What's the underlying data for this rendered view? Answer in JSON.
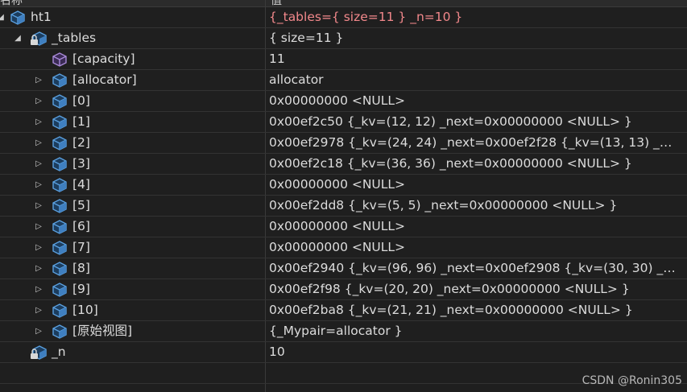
{
  "header": {
    "col_name": "名称",
    "col_value": "值"
  },
  "rows": [
    {
      "name": "ht1",
      "value": "{_tables={ size=11 } _n=10 }",
      "expander": "expanded-partial",
      "icon": "object-icon"
    },
    {
      "name": "_tables",
      "value": "{ size=11 }",
      "expander": "expanded",
      "icon": "locked-member-icon"
    },
    {
      "name": "[capacity]",
      "value": "11",
      "expander": "none",
      "icon": "property-icon"
    },
    {
      "name": "[allocator]",
      "value": "allocator",
      "expander": "collapsed",
      "icon": "object-icon"
    },
    {
      "name": "[0]",
      "value": "0x00000000 <NULL>",
      "expander": "collapsed",
      "icon": "object-icon"
    },
    {
      "name": "[1]",
      "value": "0x00ef2c50 {_kv=(12, 12) _next=0x00000000 <NULL> }",
      "expander": "collapsed",
      "icon": "object-icon"
    },
    {
      "name": "[2]",
      "value": "0x00ef2978 {_kv=(24, 24) _next=0x00ef2f28 {_kv=(13, 13) _next...",
      "expander": "collapsed",
      "icon": "object-icon"
    },
    {
      "name": "[3]",
      "value": "0x00ef2c18 {_kv=(36, 36) _next=0x00000000 <NULL> }",
      "expander": "collapsed",
      "icon": "object-icon"
    },
    {
      "name": "[4]",
      "value": "0x00000000 <NULL>",
      "expander": "collapsed",
      "icon": "object-icon"
    },
    {
      "name": "[5]",
      "value": "0x00ef2dd8 {_kv=(5, 5) _next=0x00000000 <NULL> }",
      "expander": "collapsed",
      "icon": "object-icon"
    },
    {
      "name": "[6]",
      "value": "0x00000000 <NULL>",
      "expander": "collapsed",
      "icon": "object-icon"
    },
    {
      "name": "[7]",
      "value": "0x00000000 <NULL>",
      "expander": "collapsed",
      "icon": "object-icon"
    },
    {
      "name": "[8]",
      "value": "0x00ef2940 {_kv=(96, 96) _next=0x00ef2908 {_kv=(30, 30) _next...",
      "expander": "collapsed",
      "icon": "object-icon"
    },
    {
      "name": "[9]",
      "value": "0x00ef2f98 {_kv=(20, 20) _next=0x00000000 <NULL> }",
      "expander": "collapsed",
      "icon": "object-icon"
    },
    {
      "name": "[10]",
      "value": "0x00ef2ba8 {_kv=(21, 21) _next=0x00000000 <NULL> }",
      "expander": "collapsed",
      "icon": "object-icon"
    },
    {
      "name": "[原始视图]",
      "value": "{_Mypair=allocator }",
      "expander": "collapsed",
      "icon": "object-icon"
    },
    {
      "name": "_n",
      "value": "10",
      "expander": "none",
      "icon": "locked-member-icon"
    },
    {
      "name": "",
      "value": "",
      "expander": "none",
      "icon": ""
    }
  ],
  "colors": {
    "changed_value": "#f2888b",
    "object_icon": "#5aa0e0",
    "property_icon": "#a98ad9"
  },
  "watermark": "CSDN @Ronin305"
}
